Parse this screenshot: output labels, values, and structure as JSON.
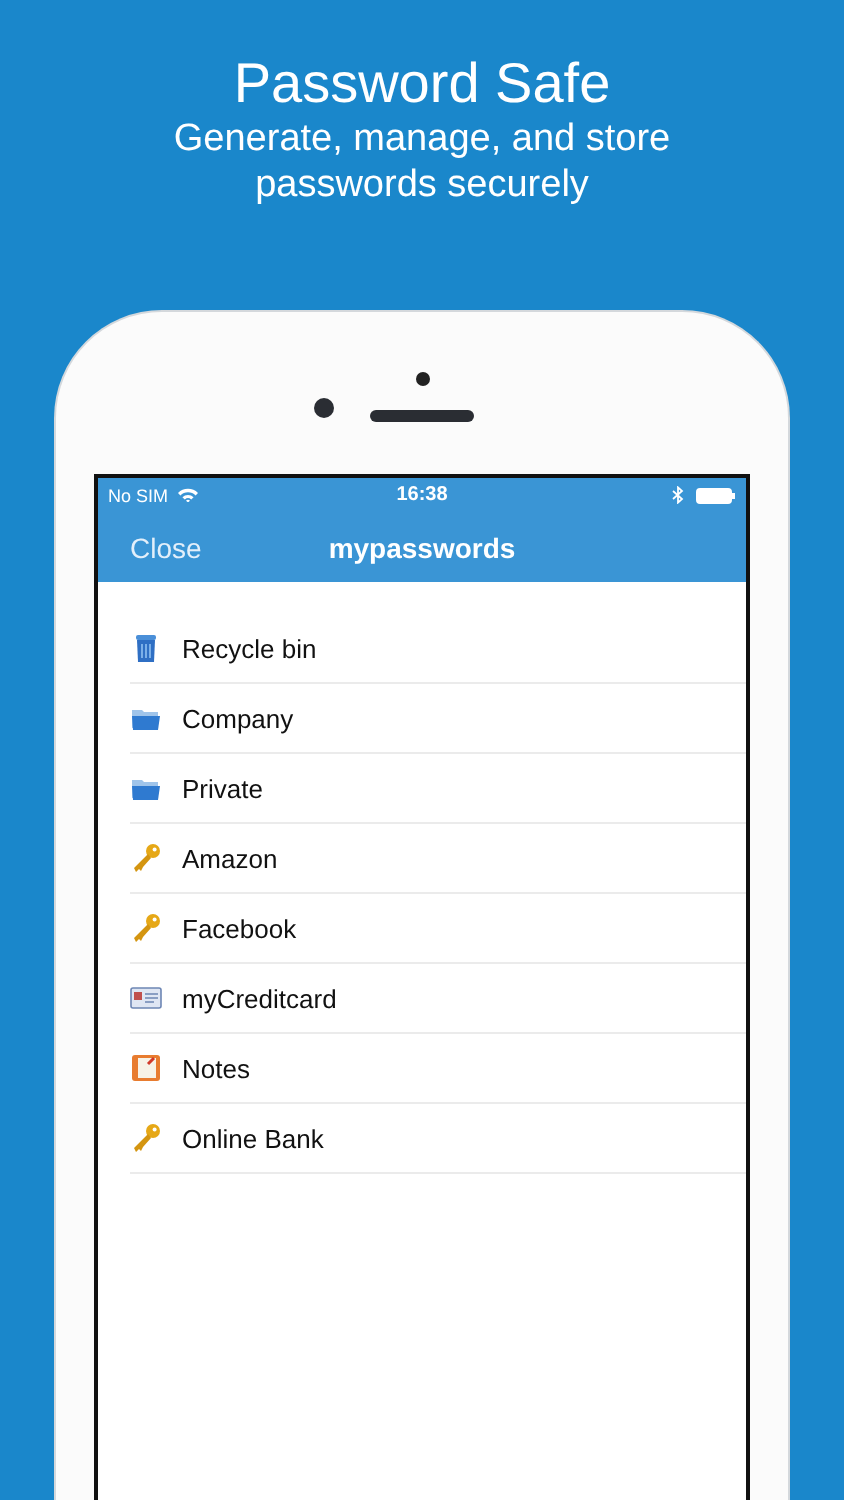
{
  "headline": {
    "title": "Password Safe",
    "subtitle": "Generate, manage, and store passwords securely"
  },
  "status_bar": {
    "carrier": "No SIM",
    "time": "16:38"
  },
  "nav_bar": {
    "left_button": "Close",
    "title": "mypasswords"
  },
  "items": [
    {
      "label": "Recycle bin",
      "kind": "trash"
    },
    {
      "label": "Company",
      "kind": "folder"
    },
    {
      "label": "Private",
      "kind": "folder"
    },
    {
      "label": "Amazon",
      "kind": "key"
    },
    {
      "label": "Facebook",
      "kind": "key"
    },
    {
      "label": "myCreditcard",
      "kind": "card"
    },
    {
      "label": "Notes",
      "kind": "notes"
    },
    {
      "label": "Online Bank",
      "kind": "key"
    }
  ]
}
